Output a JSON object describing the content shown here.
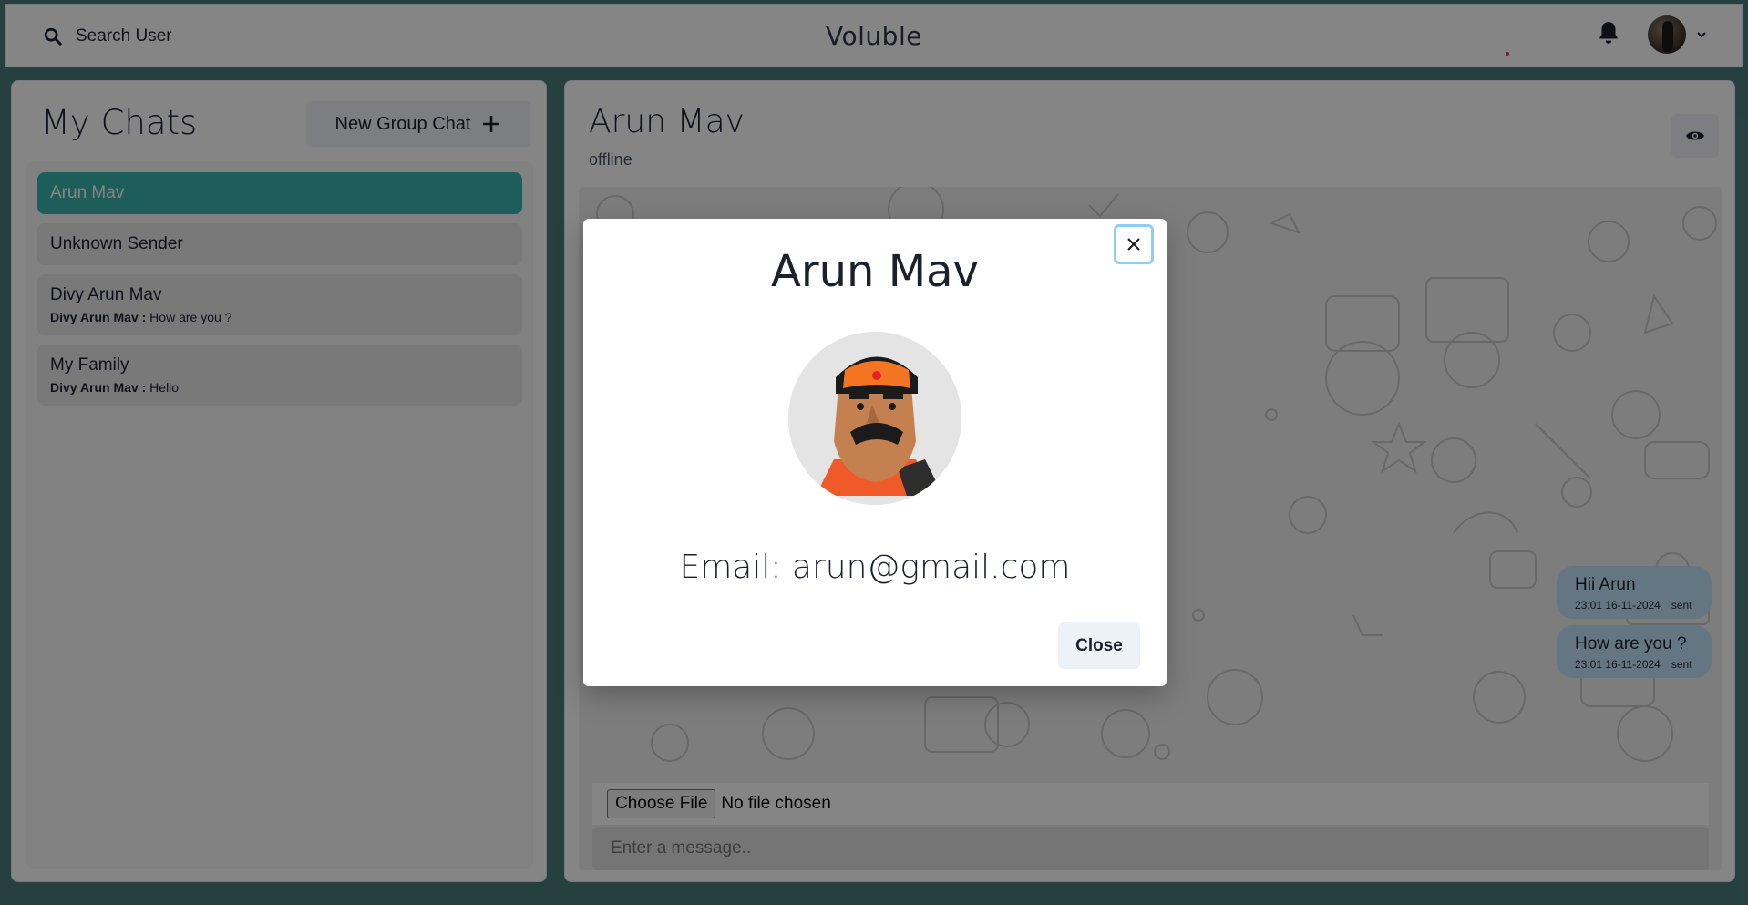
{
  "header": {
    "search_label": "Search User",
    "app_title": "Voluble"
  },
  "sidebar": {
    "title": "My Chats",
    "new_group_label": "New Group Chat",
    "chats": [
      {
        "name": "Arun Mav",
        "active": true
      },
      {
        "name": "Unknown Sender"
      },
      {
        "name": "Divy Arun Mav",
        "last_sender": "Divy Arun Mav :",
        "last_message": "How are you ?"
      },
      {
        "name": "My Family",
        "last_sender": "Divy Arun Mav :",
        "last_message": "Hello"
      }
    ]
  },
  "conversation": {
    "name": "Arun Mav",
    "status": "offline",
    "messages": [
      {
        "text": "Hii Arun",
        "time": "23:01 16-11-2024",
        "status": "sent"
      },
      {
        "text": "How are you ?",
        "time": "23:01 16-11-2024",
        "status": "sent"
      }
    ],
    "file_button": "Choose File",
    "file_status": "No file chosen",
    "input_placeholder": "Enter a message.."
  },
  "modal": {
    "title": "Arun Mav",
    "email": "Email: arun@gmail.com",
    "close_label": "Close"
  },
  "colors": {
    "accent": "#38b2ac",
    "message_bubble": "#bee3f8",
    "secondary_button": "#edf2f7",
    "page_background": "#497c7c"
  }
}
